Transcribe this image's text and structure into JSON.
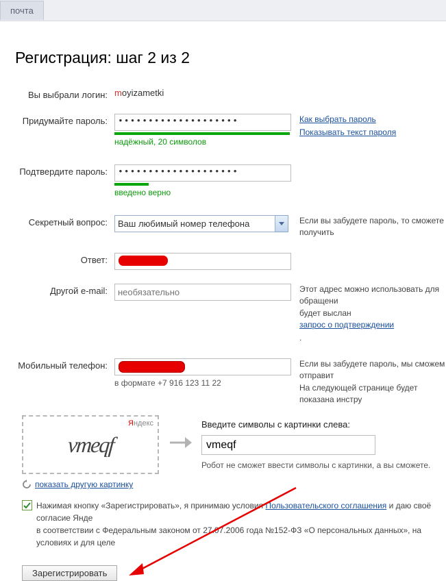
{
  "tabs": {
    "mail": "почта"
  },
  "title": "Регистрация: шаг 2 из 2",
  "rows": {
    "login": {
      "label": "Вы выбрали логин:",
      "prefix": "m",
      "rest": "oyizametki"
    },
    "password": {
      "label": "Придумайте пароль:",
      "masked": "••••••••••••••••••••",
      "strength": "надёжный, 20 символов",
      "hints": {
        "choose": "Как выбрать пароль",
        "show": "Показывать текст пароля"
      }
    },
    "confirm": {
      "label": "Подтвердите пароль:",
      "masked": "••••••••••••••••••••",
      "status": "введено верно"
    },
    "secret": {
      "label": "Секретный вопрос:",
      "selected": "Ваш любимый номер телефона",
      "hint": "Если вы забудете пароль, то сможете получить"
    },
    "answer": {
      "label": "Ответ:"
    },
    "email": {
      "label": "Другой e-mail:",
      "placeholder": "необязательно",
      "hint_pre": "Этот адрес можно использовать для обращени",
      "hint_mid": "будет выслан ",
      "hint_link": "запрос о подтверждении",
      "hint_post": "."
    },
    "phone": {
      "label": "Мобильный телефон:",
      "format": "в формате +7 916 123 11 22",
      "hint1": "Если вы забудете пароль, мы сможем отправит",
      "hint2": "На следующей странице будет показана инстру"
    }
  },
  "captcha": {
    "brand_y": "Я",
    "brand_rest": "ндекс",
    "text": "vmeqf",
    "refresh": "показать другую картинку",
    "prompt": "Введите символы с картинки слева:",
    "value": "vmeqf",
    "note": "Робот не сможет ввести символы с картинки, а вы сможете."
  },
  "agreement": {
    "text_pre": "Нажимая кнопку «Зарегистрировать», я принимаю условия ",
    "link": "Пользовательского соглашения",
    "text_mid": " и даю своё согласие Янде",
    "text_post": "в соответствии с Федеральным законом от 27.07.2006 года №152-ФЗ «О персональных данных», на условиях и для целе"
  },
  "register_button": "Зарегистрировать"
}
